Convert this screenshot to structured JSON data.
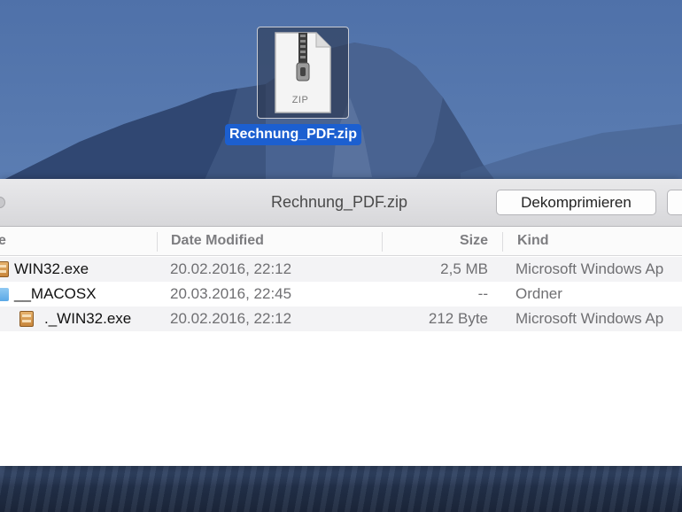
{
  "desktop": {
    "file": {
      "name": "Rechnung_PDF.zip",
      "icon_label": "ZIP",
      "icon": "zip-file-icon"
    }
  },
  "window": {
    "title": "Rechnung_PDF.zip",
    "buttons": {
      "extract_label": "Dekomprimieren",
      "second_label": ""
    },
    "columns": {
      "name": "e",
      "date": "Date Modified",
      "size": "Size",
      "kind": "Kind"
    },
    "rows": [
      {
        "name": "WIN32.exe",
        "date": "20.02.2016, 22:12",
        "size": "2,5 MB",
        "kind": "Microsoft Windows Ap",
        "icon": "exe-file-icon"
      },
      {
        "name": "__MACOSX",
        "date": "20.03.2016, 22:45",
        "size": "--",
        "kind": "Ordner",
        "icon": "folder-icon"
      },
      {
        "name": "._WIN32.exe",
        "date": "20.02.2016, 22:12",
        "size": "212 Byte",
        "kind": "Microsoft Windows Ap",
        "icon": "exe-file-icon"
      }
    ]
  },
  "colors": {
    "selection": "#1c5fd0",
    "folder": "#6cb4ea",
    "exe_icon": "#d2954a"
  }
}
